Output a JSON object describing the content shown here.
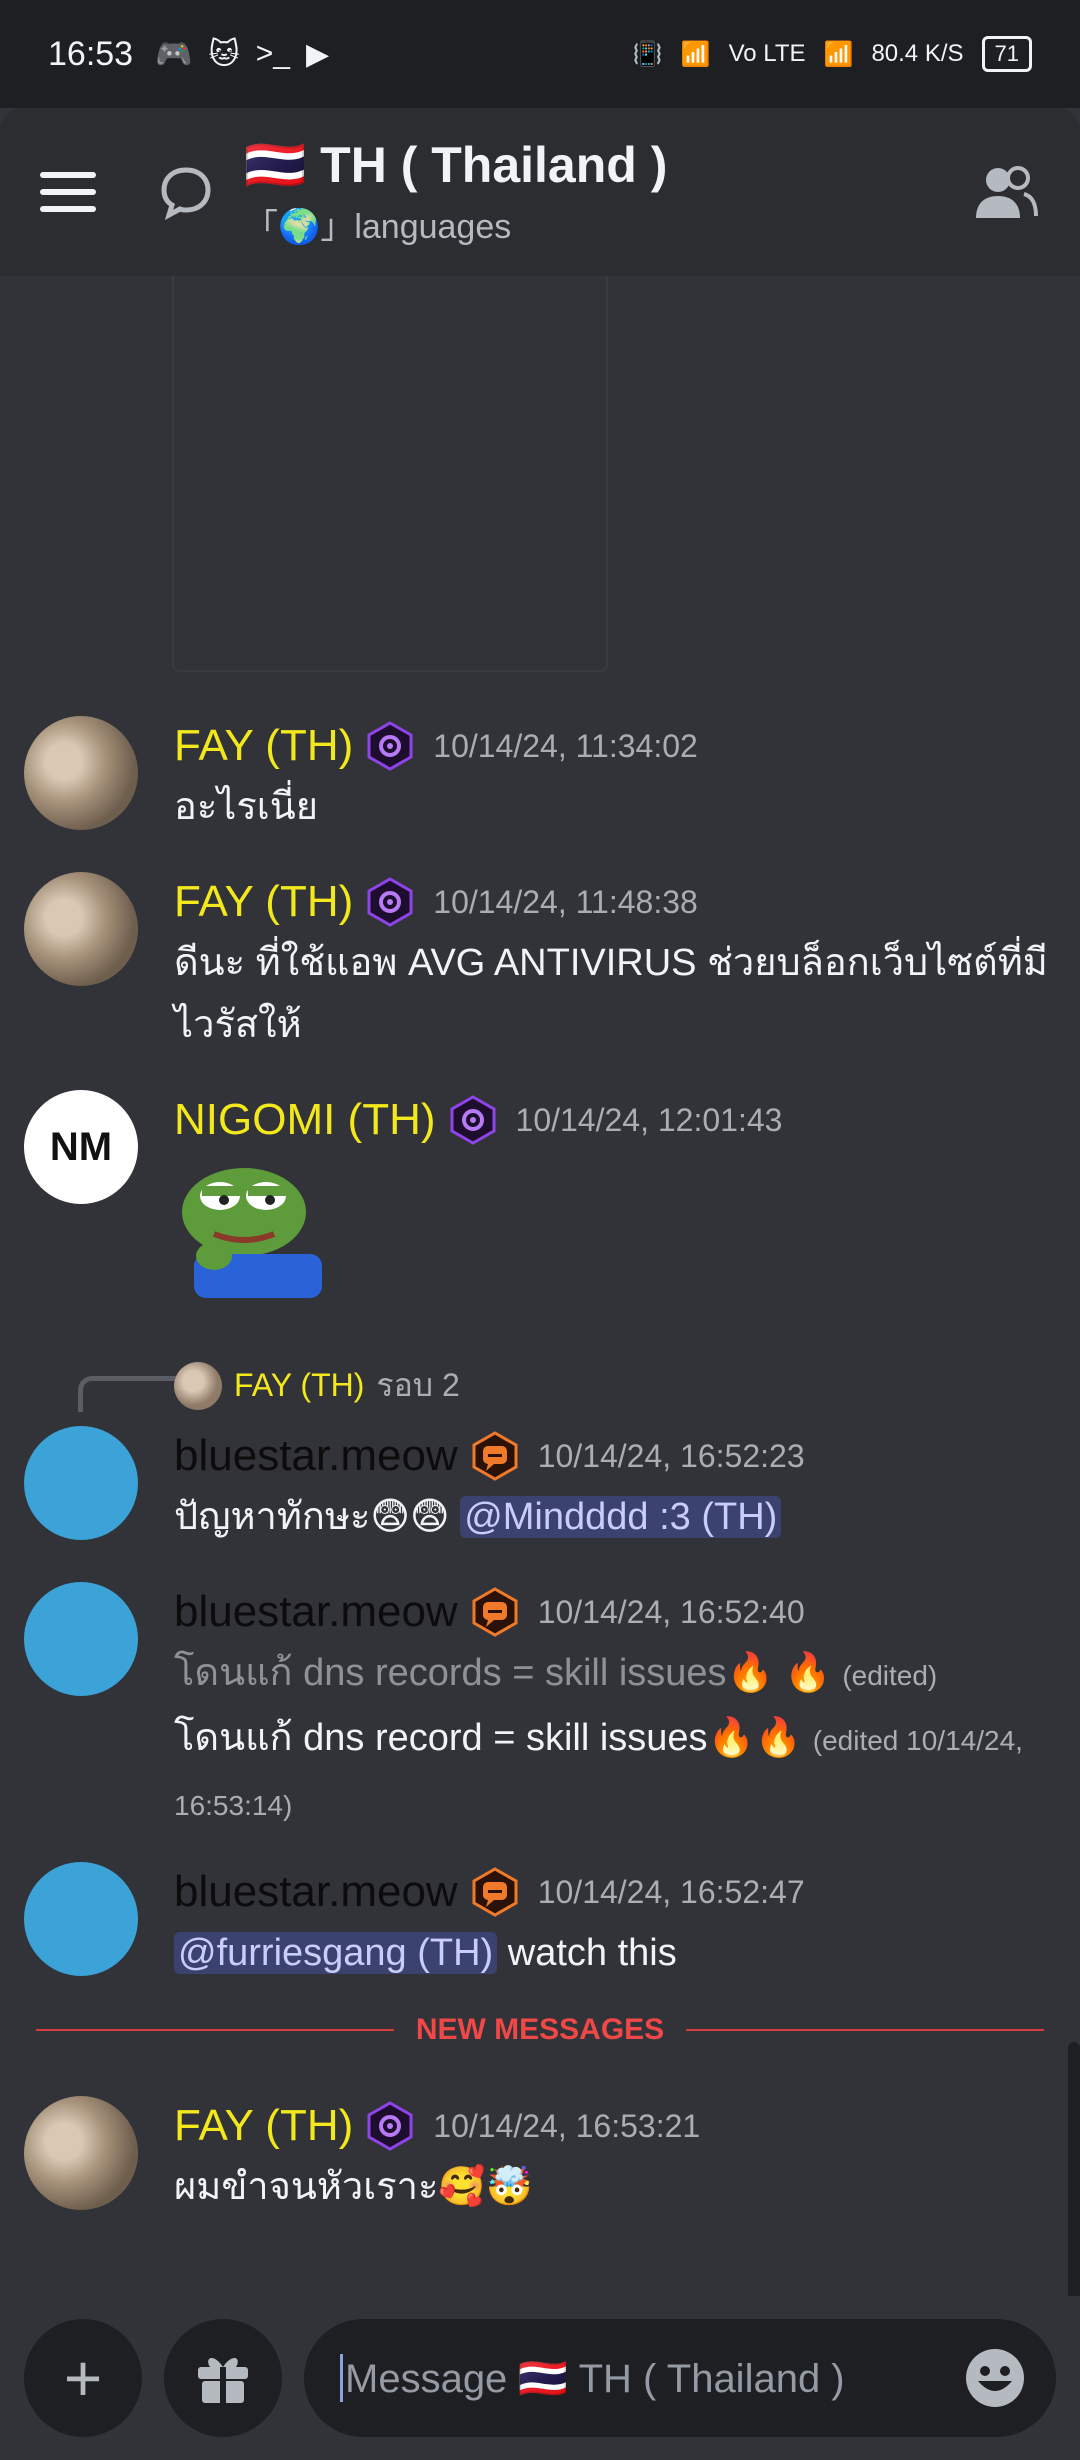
{
  "status_bar": {
    "time": "16:53",
    "net_speed": "80.4",
    "net_unit": "K/S",
    "volte": "Vo LTE",
    "battery": "71"
  },
  "header": {
    "title": "🇹🇭 TH ( Thailand )",
    "subtitle": "「🌍」languages"
  },
  "messages": [
    {
      "user": "FAY (TH)",
      "timestamp": "10/14/24, 11:34:02",
      "text": "อะไรเนี่ย"
    },
    {
      "user": "FAY (TH)",
      "timestamp": "10/14/24, 11:48:38",
      "text": "ดีนะ  ที่ใช้แอพ AVG ANTIVIRUS ช่วยบล็อกเว็บไซต์ที่มีไวรัสให้"
    },
    {
      "user": "NIGOMI (TH)",
      "timestamp": "10/14/24, 12:01:43",
      "avatar_text": "NM"
    },
    {
      "reply_to_user": "FAY (TH)",
      "reply_preview": "รอบ 2",
      "user": "bluestar.meow",
      "timestamp": "10/14/24, 16:52:23",
      "text": "ปัญหาทักษะ😨😨",
      "mention": "@Mindddd :3 (TH)"
    },
    {
      "user": "bluestar.meow",
      "timestamp": "10/14/24, 16:52:40",
      "old_text": "โดนแก้ dns records = skill issues🔥 🔥",
      "old_edited": "(edited)",
      "text": "โดนแก้ dns record = skill issues🔥🔥",
      "edited": "(edited 10/14/24, 16:53:14)"
    },
    {
      "user": "bluestar.meow",
      "timestamp": "10/14/24, 16:52:47",
      "mention": "@furriesgang (TH)",
      "text": " watch this"
    },
    {
      "user": "FAY (TH)",
      "timestamp": "10/14/24, 16:53:21",
      "text": "ผมขำจนหัวเราะ🥰🤯"
    }
  ],
  "divider": {
    "label": "NEW MESSAGES"
  },
  "composer": {
    "placeholder": "Message 🇹🇭 TH ( Thailand )"
  },
  "colors": {
    "role_yellow": "#f3e81c",
    "new_messages_red": "#f04747",
    "mention_bg": "#3c4270"
  }
}
